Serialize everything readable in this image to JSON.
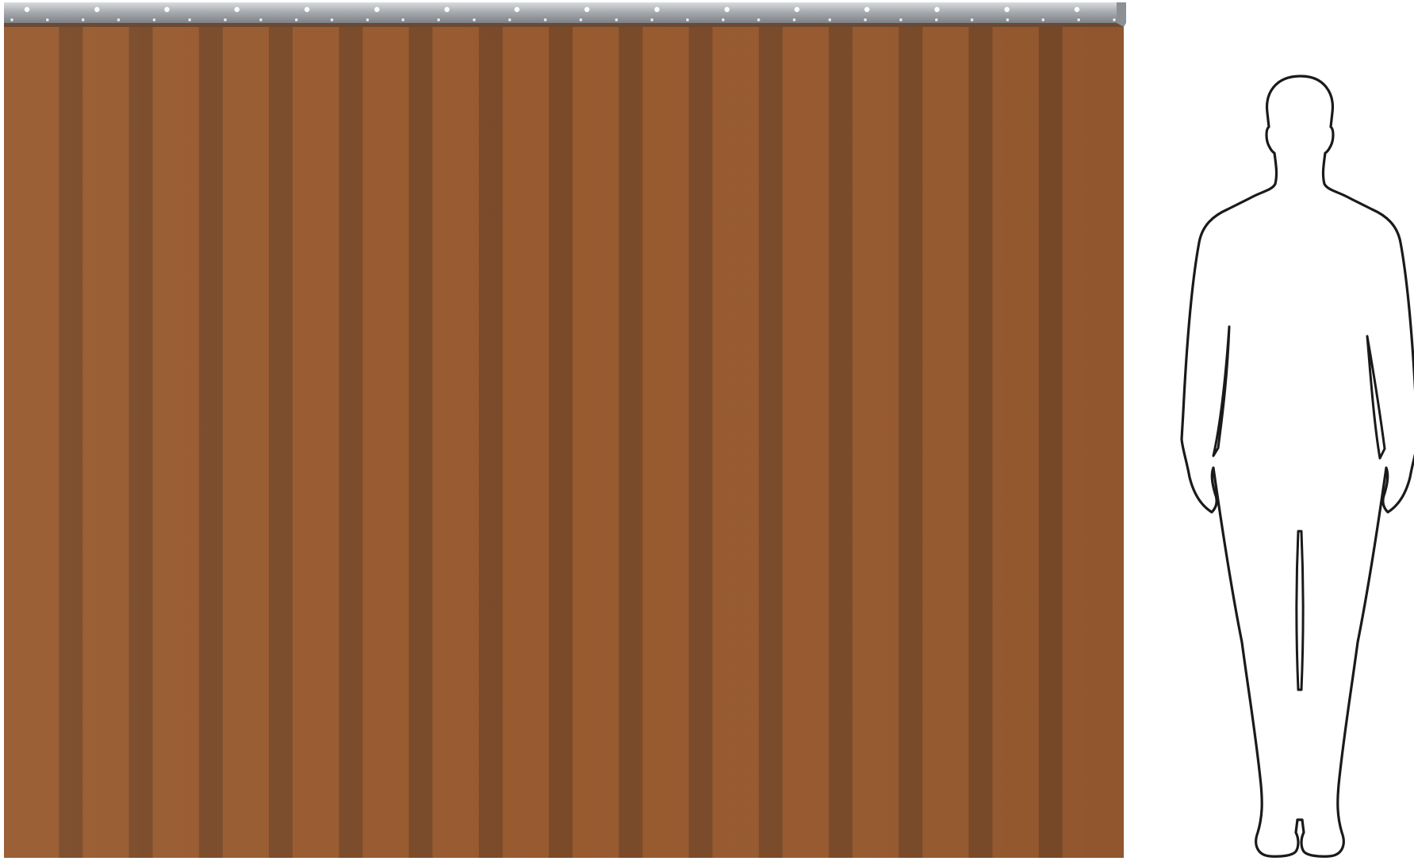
{
  "scene": {
    "subject": "pvc-strip-curtain",
    "scale_reference": "human-silhouette"
  },
  "curtain": {
    "strip_count": 16,
    "overlap_count": 15,
    "colors": {
      "strip": "#985a2f",
      "overlap": "#7a4a29",
      "rail": "#b8bcc0",
      "rail_dark": "#7d8186",
      "rail_edge": "#6a4a34",
      "bolt": "#ffffff"
    }
  },
  "silhouette": {
    "colors": {
      "fill": "#ffffff",
      "stroke": "#1a1a1a"
    }
  }
}
